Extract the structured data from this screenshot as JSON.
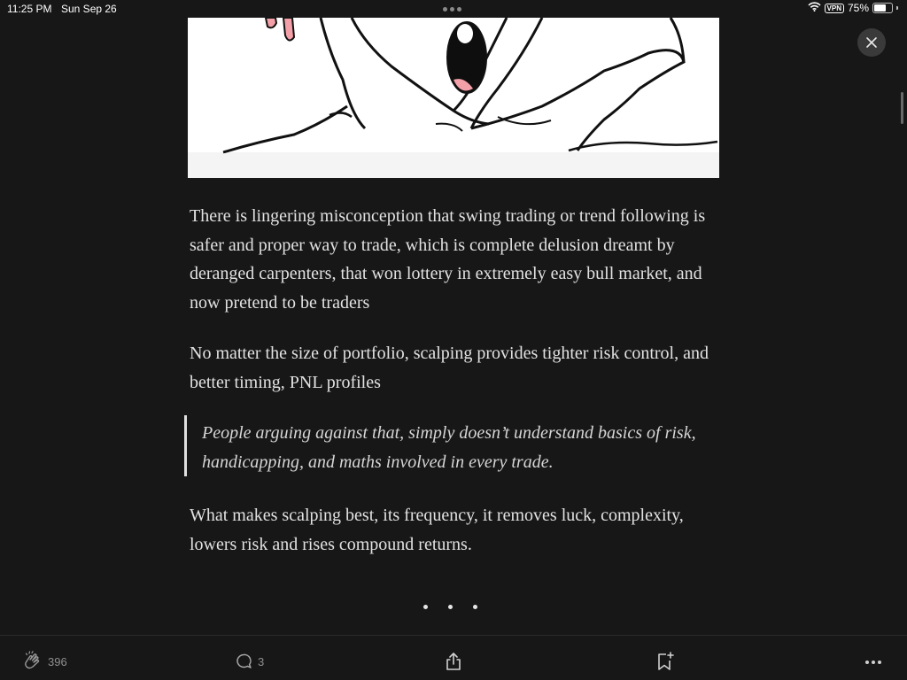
{
  "status_bar": {
    "time": "11:25 PM",
    "date": "Sun Sep 26",
    "vpn": "VPN",
    "battery_percent": "75%",
    "battery_level": 0.75
  },
  "article": {
    "paragraphs": [
      "There is lingering misconception that swing trading or trend following is safer and proper way to trade, which is complete delusion dreamt by deranged carpenters, that won lottery in extremely easy bull market, and now pretend to be traders",
      "No matter the size of portfolio, scalping provides tighter risk control, and better timing, PNL profiles"
    ],
    "pullquote": "People arguing against that, simply doesn’t understand basics of risk, handicapping, and maths involved in every trade.",
    "closing_paragraph": "What makes scalping best, its frequency, it removes luck, complexity, lowers risk and rises compound returns."
  },
  "toolbar": {
    "clap_count": "396",
    "response_count": "3"
  },
  "icons": {
    "close": "close-icon",
    "clap": "clap-icon",
    "response": "comment-bubble-icon",
    "share": "share-icon",
    "bookmark": "bookmark-add-icon",
    "more": "more-options-icon",
    "wifi": "wifi-icon",
    "battery": "battery-icon"
  }
}
